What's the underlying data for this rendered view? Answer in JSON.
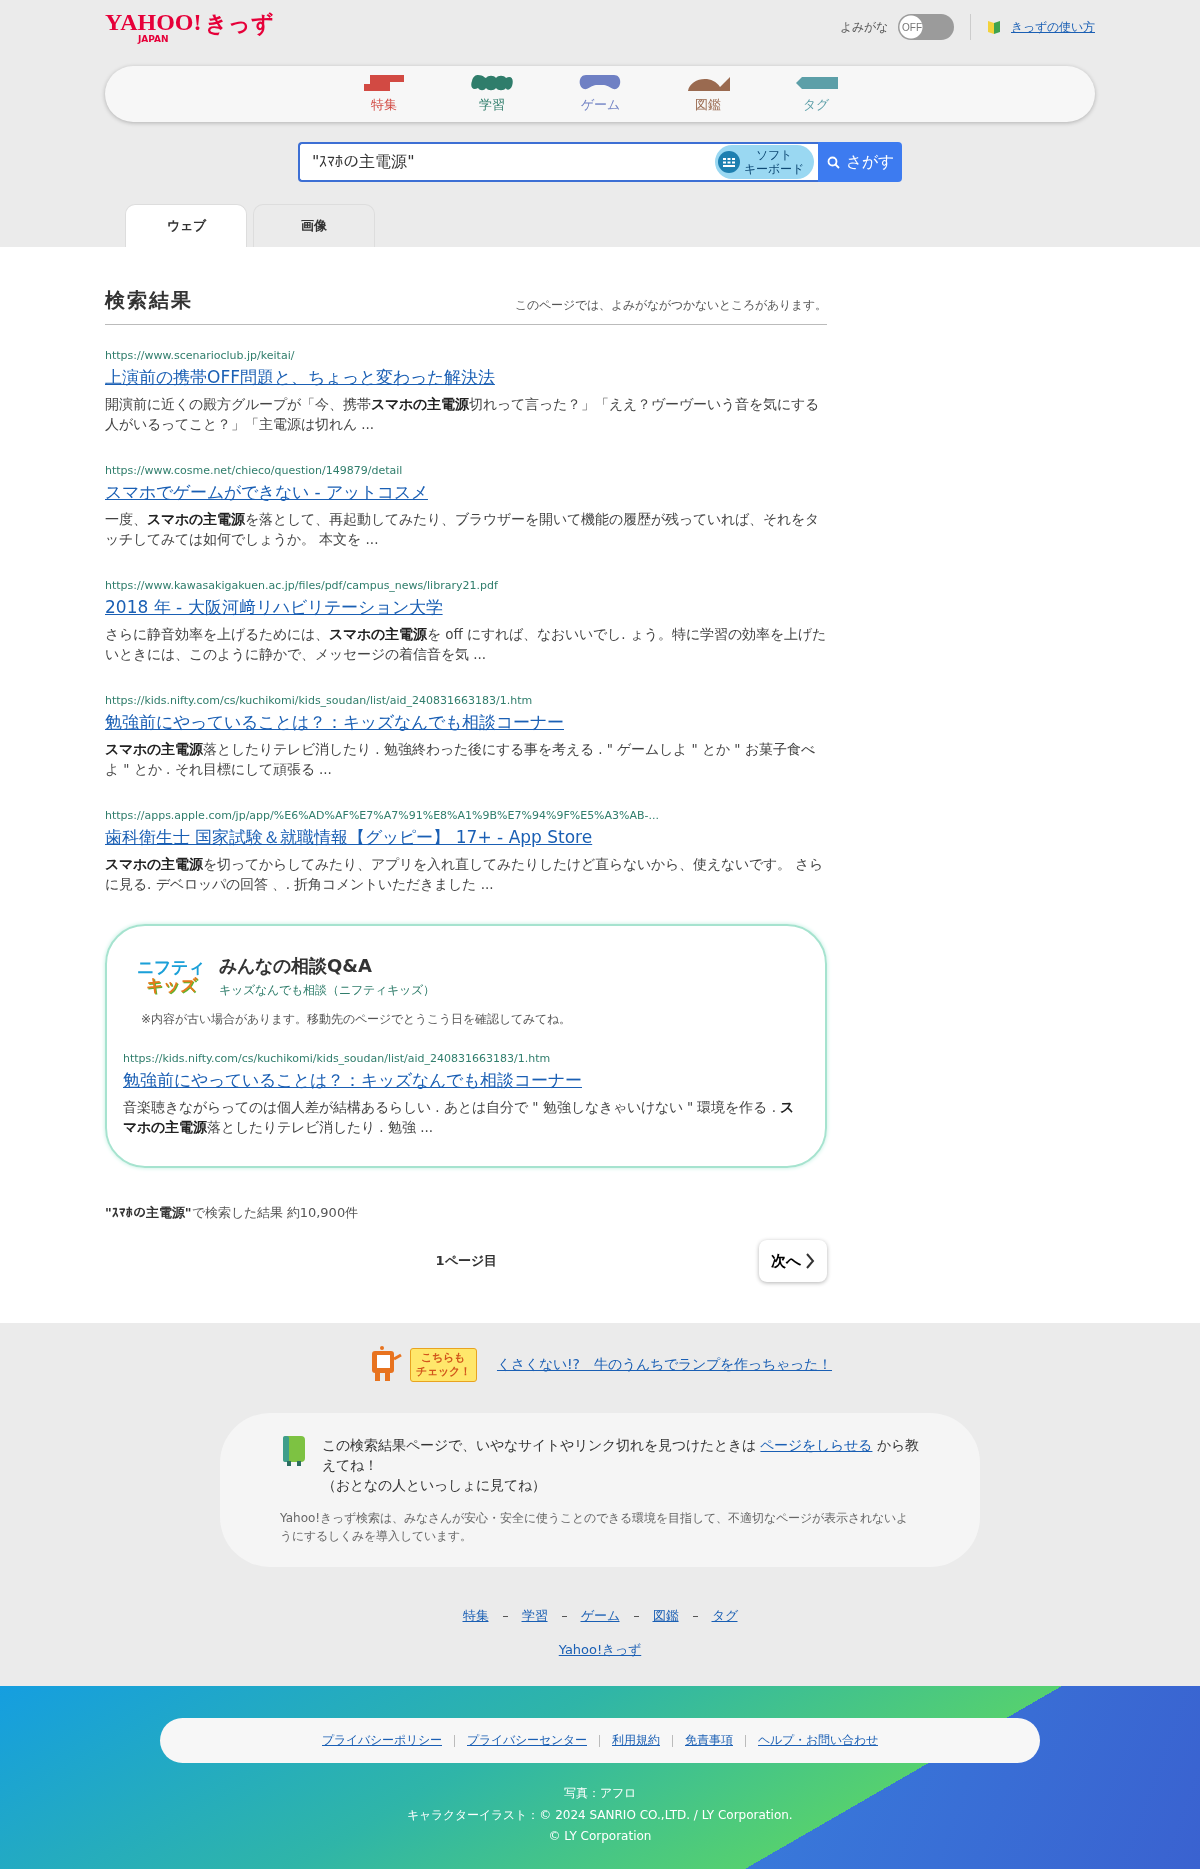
{
  "header": {
    "logo": "YAHOO!",
    "logo_sub": "JAPAN",
    "logo_kids": "きっず",
    "yomigana": {
      "label": "よみがな",
      "toggle": "OFF",
      "on": false
    },
    "help_link": "きっずの使い方"
  },
  "nav": [
    {
      "label": "特集",
      "color": "#d24a43"
    },
    {
      "label": "学習",
      "color": "#2f7d6b"
    },
    {
      "label": "ゲーム",
      "color": "#6f80c4"
    },
    {
      "label": "図鑑",
      "color": "#9a6a50"
    },
    {
      "label": "タグ",
      "color": "#5c9fa8"
    }
  ],
  "search": {
    "value": "\"ｽﾏﾎの主電源\"",
    "keyboard_lines": [
      "ソフト",
      "キーボード"
    ],
    "button": "さがす"
  },
  "tabs": [
    {
      "label": "ウェブ",
      "selected": true
    },
    {
      "label": "画像",
      "selected": false
    }
  ],
  "results_heading": "検索結果",
  "results_note": "このページでは、よみがながつかないところがあります。",
  "results": [
    {
      "url": "https://www.scenarioclub.jp/keitai/",
      "title": "上演前の携帯OFF問題と、ちょっと変わった解決法",
      "snippet": "開演前に近くの殿方グループが「今、携帯**スマホの主電源**切れって言った？」「ええ？ヴーヴーいう音を気にする人がいるってこと？」「主電源は切れん ..."
    },
    {
      "url": "https://www.cosme.net/chieco/question/149879/detail",
      "title": "スマホでゲームができない - アットコスメ",
      "snippet": "一度、**スマホの主電源**を落として、再起動してみたり、ブラウザーを開いて機能の履歴が残っていれば、それをタッチしてみては如何でしょうか。 本文を ..."
    },
    {
      "url": "https://www.kawasakigakuen.ac.jp/files/pdf/campus_news/library21.pdf",
      "title": "2018 年 - 大阪河﨑リハビリテーション大学",
      "snippet": "さらに静音効率を上げるためには、**スマホの主電源**を off にすれば、なおいいでし. ょう。特に学習の効率を上げたいときには、このように静かで、メッセージの着信音を気 ..."
    },
    {
      "url": "https://kids.nifty.com/cs/kuchikomi/kids_soudan/list/aid_240831663183/1.htm",
      "title": "勉強前にやっていることは？：キッズなんでも相談コーナー",
      "snippet": "**スマホの主電源**落としたりテレビ消したり . 勉強終わった後にする事を考える . \" ゲームしよ \" とか \" お菓子食べよ \" とか . それ目標にして頑張る ..."
    },
    {
      "url": "https://apps.apple.com/jp/app/%E6%AD%AF%E7%A7%91%E8%A1%9B%E7%94%9F%E5%A3%AB-...",
      "title": "歯科衛生士 国家試験＆就職情報【グッピー】 17+ - App Store",
      "snippet": "**スマホの主電源**を切ってからしてみたり、アプリを入れ直してみたりしたけど直らないから、使えないです。 さらに見る. デベロッパの回答 、. 折角コメントいただきました ..."
    }
  ],
  "featured": {
    "logo_lines": [
      "ニフティ",
      "キッズ"
    ],
    "title": "みんなの相談Q&A",
    "subtitle": "キッズなんでも相談（ニフティキッズ）",
    "note": "※内容が古い場合があります。移動先のページでとうこう日を確認してみてね。",
    "url": "https://kids.nifty.com/cs/kuchikomi/kids_soudan/list/aid_240831663183/1.htm",
    "title_link": "勉強前にやっていることは？：キッズなんでも相談コーナー",
    "snippet": "音楽聴きながらってのは個人差が結構あるらしい . あとは自分で \" 勉強しなきゃいけない \" 環境を作る . **スマホの主電源**落としたりテレビ消したり . 勉強 ..."
  },
  "summary": "**\"ｽﾏﾎの主電源\"**で検索した結果 約10,900件",
  "pagination": {
    "page": "1ページ目",
    "next": "次へ"
  },
  "promo": {
    "badge_lines": [
      "こちらも",
      "チェック！"
    ],
    "link": "くさくない!?　牛のうんちでランプを作っちゃった！"
  },
  "notice": {
    "text_before": "この検索結果ページで、いやなサイトやリンク切れを見つけたときは",
    "link": "ページをしらせる",
    "text_after": "から教えてね！",
    "text_line2": "（おとなの人といっしょに見てね）",
    "disclaimer": "Yahoo!きっず検索は、みなさんが安心・安全に使うことのできる環境を目指して、不適切なページが表示されないようにするしくみを導入しています。"
  },
  "footer_nav": [
    "特集",
    "学習",
    "ゲーム",
    "図鑑",
    "タグ"
  ],
  "footer_home": "Yahoo!きっず",
  "legal_links": [
    "プライバシーポリシー",
    "プライバシーセンター",
    "利用規約",
    "免責事項",
    "ヘルプ・お問い合わせ"
  ],
  "credits": [
    "写真：アフロ",
    "キャラクターイラスト：© 2024 SANRIO CO.,LTD. / LY Corporation.",
    "© LY Corporation"
  ]
}
